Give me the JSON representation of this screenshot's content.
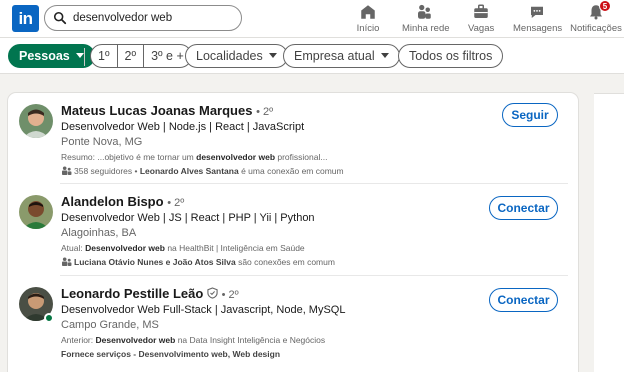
{
  "nav": {
    "logo": "in",
    "search_value": "desenvolvedor web",
    "items": [
      {
        "label": "Início",
        "icon": "home-icon"
      },
      {
        "label": "Minha rede",
        "icon": "network-icon"
      },
      {
        "label": "Vagas",
        "icon": "briefcase-icon"
      },
      {
        "label": "Mensagens",
        "icon": "chat-icon"
      },
      {
        "label": "Notificações",
        "icon": "bell-icon",
        "badge": "5"
      }
    ]
  },
  "filters": {
    "people": "Pessoas",
    "degrees": [
      "1º",
      "2º",
      "3º e +"
    ],
    "locations": "Localidades",
    "company": "Empresa atual",
    "all": "Todos os filtros"
  },
  "colors": {
    "accent": "#0a66c2",
    "active_filter": "#01754f",
    "badge": "#cc1016",
    "online": "#057642"
  },
  "results": [
    {
      "name": "Mateus Lucas Joanas Marques",
      "degree": "• 2º",
      "headline": "Desenvolvedor Web | Node.js | React | JavaScript",
      "location": "Ponte Nova, MG",
      "snippet_prefix": "Resumo: ...objetivo é me tornar um ",
      "snippet_bold": "desenvolvedor web",
      "snippet_suffix": " profissional...",
      "conn_text": "358 seguidores • ",
      "conn_bold": "Leonardo Alves Santana",
      "conn_suffix": " é uma conexão em comum",
      "action": "Seguir"
    },
    {
      "name": "Alandelon Bispo",
      "degree": "• 2º",
      "headline": "Desenvolvedor Web | JS | React | PHP | Yii | Python",
      "location": "Alagoinhas, BA",
      "snippet_prefix": "Atual: ",
      "snippet_bold": "Desenvolvedor web",
      "snippet_suffix": " na HealthBit | Inteligência em Saúde",
      "conn_text": "",
      "conn_bold": "Luciana Otávio Nunes e João Atos Silva",
      "conn_suffix": " são conexões em comum",
      "action": "Conectar"
    },
    {
      "name": "Leonardo Pestille Leão",
      "degree": "• 2º",
      "headline": "Desenvolvedor Web Full-Stack | Javascript, Node, MySQL",
      "location": "Campo Grande, MS",
      "snippet_prefix": "Anterior: ",
      "snippet_bold": "Desenvolvedor web",
      "snippet_suffix": " na Data Insight Inteligência e Negócios",
      "conn_bold": "Fornece serviços - Desenvolvimento web, Web design",
      "action": "Conectar"
    }
  ]
}
